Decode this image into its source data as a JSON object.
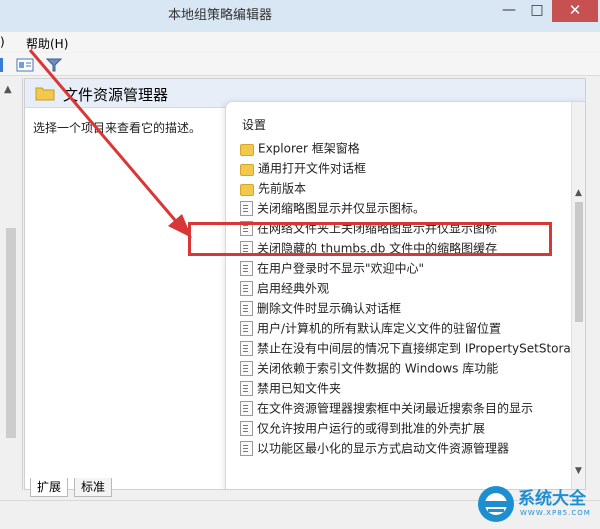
{
  "window": {
    "title": "本地组策略编辑器",
    "minimize_glyph": "—",
    "maximize_glyph": "□",
    "close_glyph": "✕"
  },
  "menu": {
    "cut_label": ")",
    "help_label": "帮助(H)"
  },
  "toolbar": {
    "icons": [
      "view-icon",
      "filter-icon"
    ]
  },
  "header": {
    "title": "文件资源管理器",
    "icon": "folder-icon"
  },
  "description": "选择一个项目来查看它的描述。",
  "list": {
    "column_header": "设置",
    "items": [
      {
        "label": "Explorer 框架窗格",
        "icon": "folder-icon"
      },
      {
        "label": "通用打开文件对话框",
        "icon": "folder-icon"
      },
      {
        "label": "先前版本",
        "icon": "folder-icon"
      },
      {
        "label": "关闭缩略图显示并仅显示图标。",
        "icon": "policy-icon"
      },
      {
        "label": "在网络文件夹上关闭缩略图显示并仅显示图标",
        "icon": "policy-icon"
      },
      {
        "label": "关闭隐藏的 thumbs.db 文件中的缩略图缓存",
        "icon": "policy-icon"
      },
      {
        "label": "在用户登录时不显示\"欢迎中心\"",
        "icon": "policy-icon"
      },
      {
        "label": "启用经典外观",
        "icon": "policy-icon"
      },
      {
        "label": "删除文件时显示确认对话框",
        "icon": "policy-icon"
      },
      {
        "label": "用户/计算机的所有默认库定义文件的驻留位置",
        "icon": "policy-icon"
      },
      {
        "label": "禁止在没有中间层的情况下直接绑定到 IPropertySetStora...",
        "icon": "policy-icon"
      },
      {
        "label": "关闭依赖于索引文件数据的 Windows 库功能",
        "icon": "policy-icon"
      },
      {
        "label": "禁用已知文件夹",
        "icon": "policy-icon"
      },
      {
        "label": "在文件资源管理器搜索框中关闭最近搜索条目的显示",
        "icon": "policy-icon"
      },
      {
        "label": "仅允许按用户运行的或得到批准的外壳扩展",
        "icon": "policy-icon"
      },
      {
        "label": "以功能区最小化的显示方式启动文件资源管理器",
        "icon": "policy-icon"
      }
    ]
  },
  "tabs": [
    {
      "label": "扩展"
    },
    {
      "label": "标准"
    }
  ],
  "watermark": {
    "text": "系统大全",
    "url": "WWW.XP85.COM"
  },
  "colors": {
    "highlight": "#d93636",
    "arrow": "#d93636",
    "brand": "#1d8fd1"
  }
}
